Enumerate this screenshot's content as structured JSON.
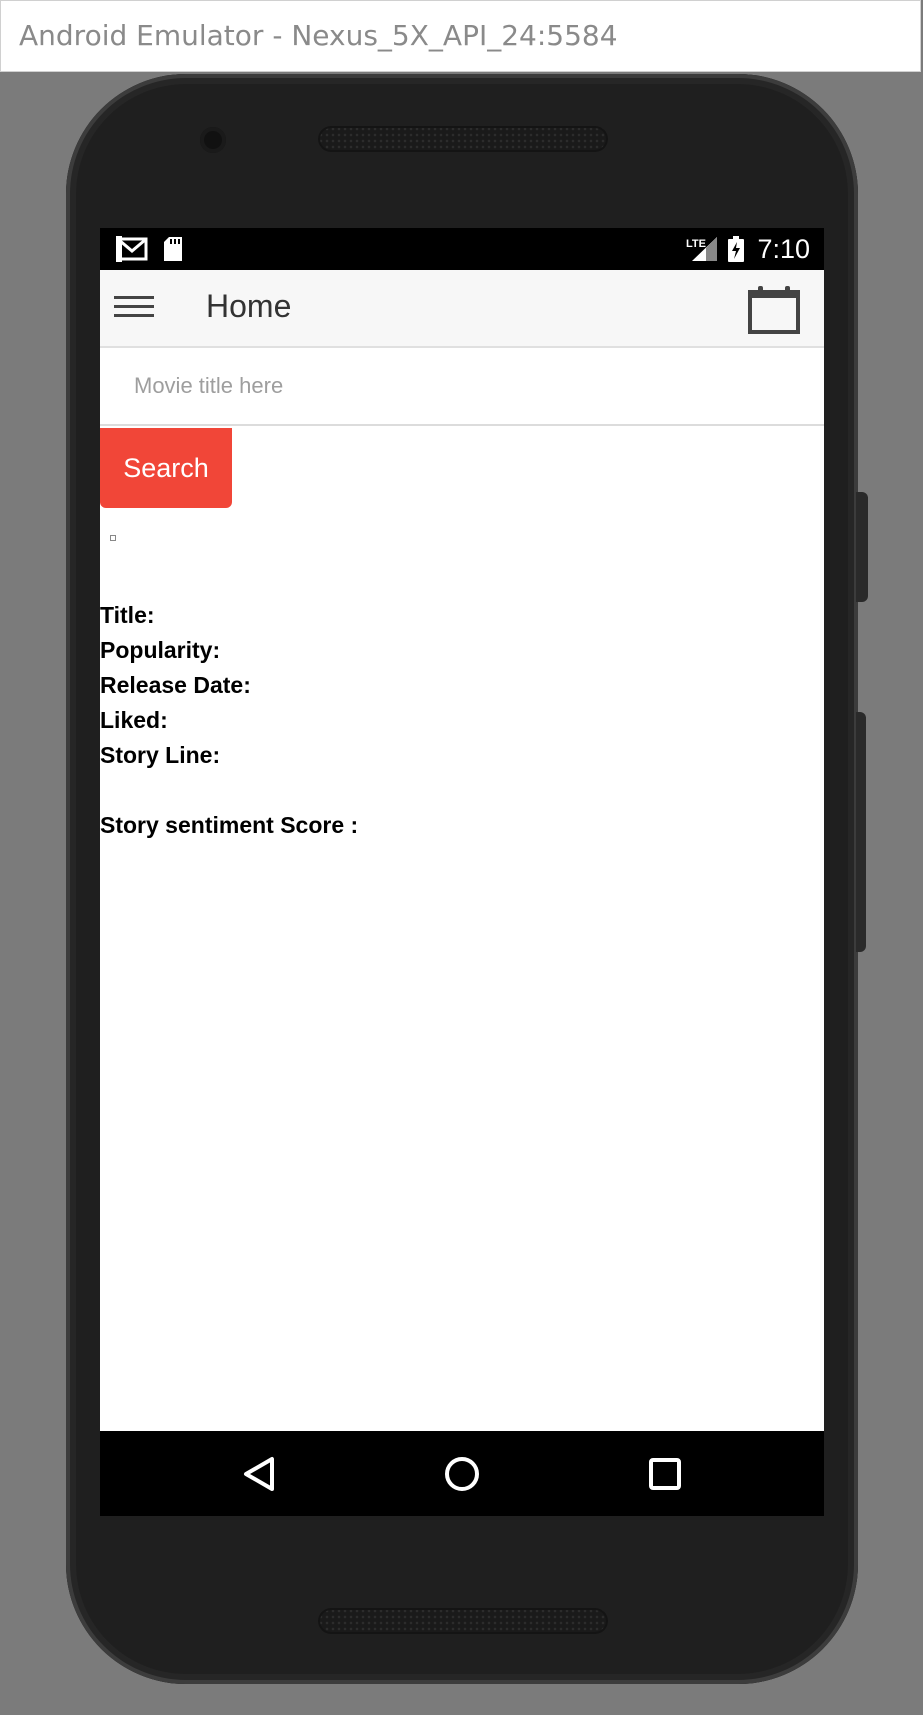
{
  "window": {
    "title": "Android Emulator - Nexus_5X_API_24:5584"
  },
  "status_bar": {
    "time": "7:10",
    "icons": [
      "gmail-icon",
      "sd-card-icon",
      "lte-signal-icon",
      "battery-charging-icon"
    ]
  },
  "app_bar": {
    "title": "Home",
    "menu_icon": "hamburger-menu-icon",
    "action_icon": "calendar-icon"
  },
  "search": {
    "placeholder": "Movie title here",
    "value": "",
    "button_label": "Search",
    "button_color": "#f14638"
  },
  "movie_info": {
    "title_label": "Title:",
    "popularity_label": "Popularity:",
    "release_date_label": "Release Date:",
    "liked_label": "Liked:",
    "story_line_label": "Story Line:",
    "sentiment_label": "Story sentiment Score :"
  },
  "nav_bar": {
    "icons": [
      "back-icon",
      "home-icon",
      "recents-icon"
    ]
  }
}
